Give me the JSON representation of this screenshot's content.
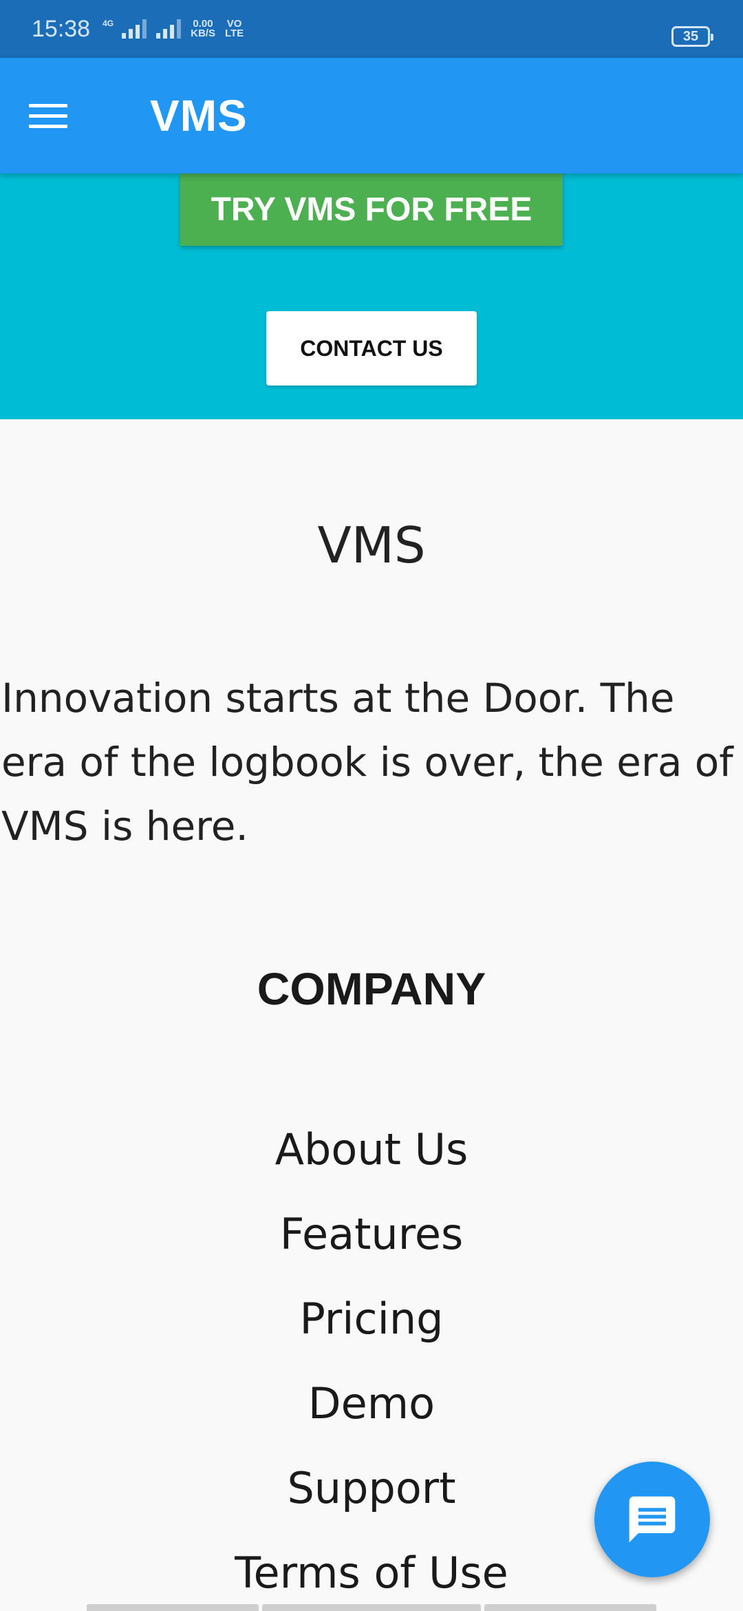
{
  "status_bar": {
    "time": "15:38",
    "network_type": "4G",
    "data_rate_value": "0.00",
    "data_rate_unit": "KB/S",
    "volte_top": "VO",
    "volte_bottom": "LTE",
    "battery": "35"
  },
  "app_bar": {
    "title": "VMS",
    "menu_icon": "hamburger-menu-icon"
  },
  "hero": {
    "try_button_label": "TRY VMS FOR FREE",
    "contact_button_label": "CONTACT US"
  },
  "about": {
    "heading": "VMS",
    "tagline": "Innovation starts at the Door. The era of the logbook is over, the era of VMS is here."
  },
  "company": {
    "heading": "COMPANY",
    "links": [
      {
        "label": "About Us"
      },
      {
        "label": "Features"
      },
      {
        "label": "Pricing"
      },
      {
        "label": "Demo"
      },
      {
        "label": "Support"
      },
      {
        "label": "Terms of Use"
      }
    ]
  },
  "chat_fab": {
    "icon": "chat-message-icon"
  },
  "colors": {
    "status_bar": "#1b6db8",
    "app_bar": "#2196f3",
    "hero_band": "#00bcd4",
    "try_button": "#4caf50",
    "background": "#f9f9f9"
  }
}
